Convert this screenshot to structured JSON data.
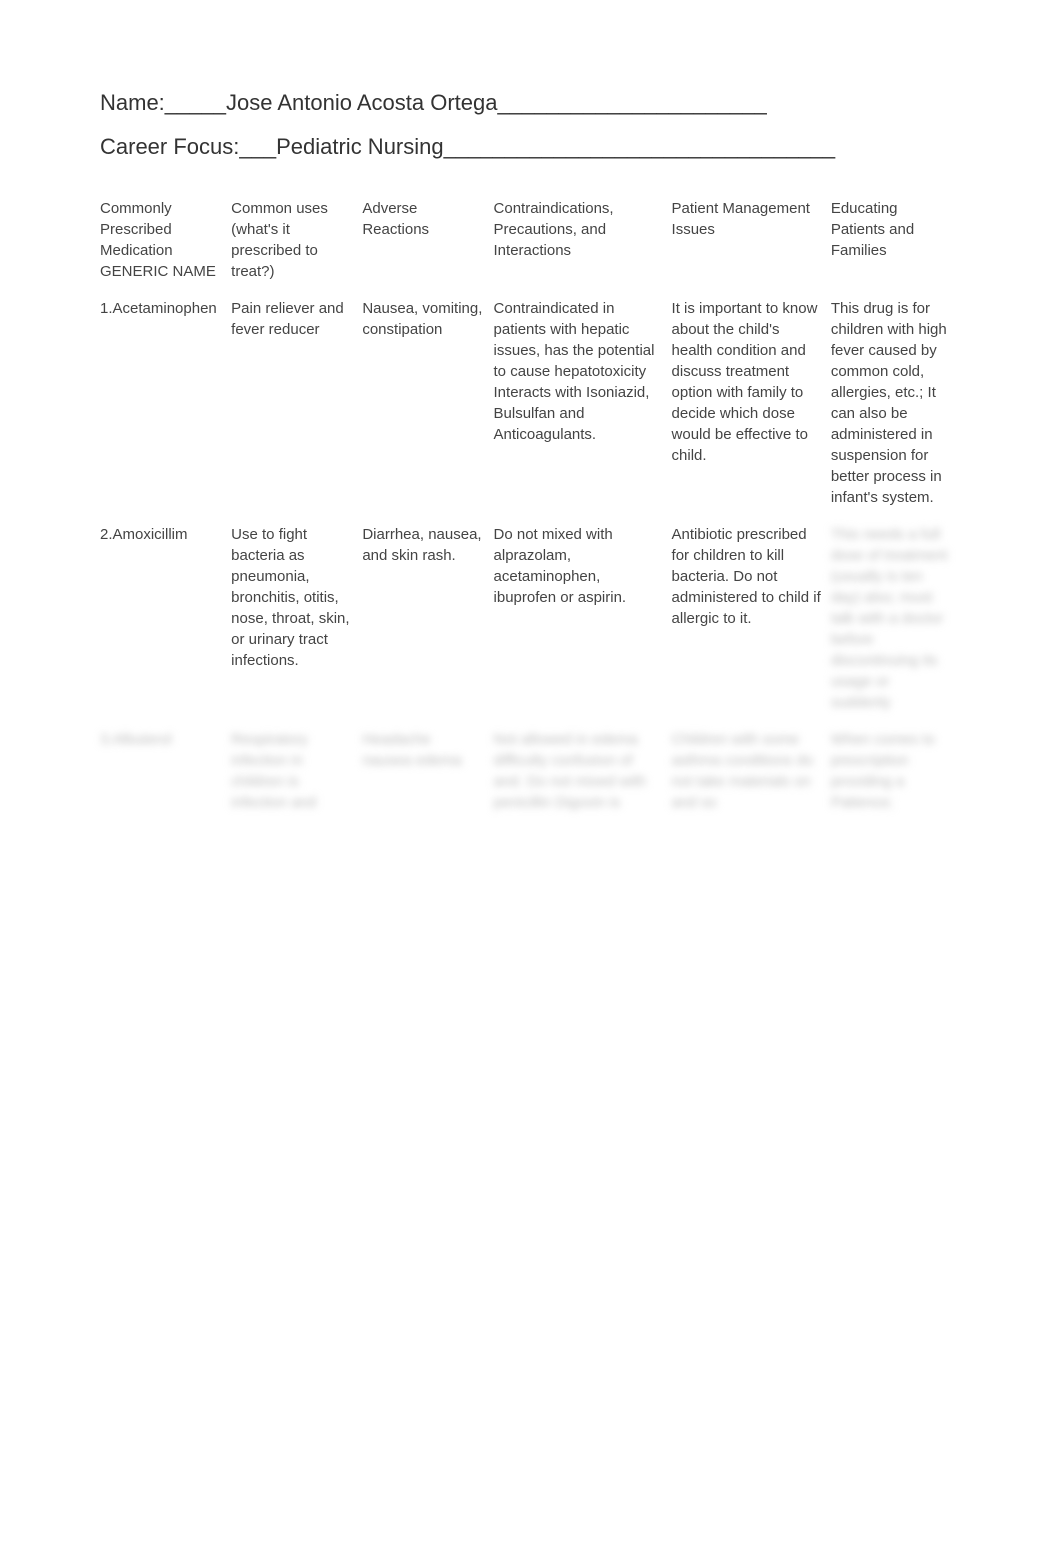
{
  "header": {
    "name_label": "Name:_____",
    "name_value": "Jose Antonio Acosta Ortega",
    "name_trailing": "______________________",
    "career_label": "Career Focus:___",
    "career_value": "Pediatric Nursing",
    "career_trailing": "________________________________"
  },
  "table": {
    "headers": [
      "Commonly Prescribed Medication GENERIC NAME",
      "Common uses (what's it prescribed to treat?)",
      "Adverse Reactions",
      "Contraindications, Precautions, and Interactions",
      "Patient Management Issues",
      "Educating Patients and Families"
    ],
    "rows": [
      {
        "cells": [
          "1.Acetaminophen",
          "Pain reliever and fever reducer",
          "Nausea, vomiting, constipation",
          "Contraindicated in patients with hepatic issues, has the potential to cause hepatotoxicity Interacts with Isoniazid, Bulsulfan and Anticoagulants.",
          "It is important to know about the child's health condition and discuss treatment option with family to decide which dose would be effective to child.",
          "This drug is for children with high fever caused by common cold, allergies, etc.; It can also be administered in suspension for better process in infant's system."
        ],
        "blurred": [
          false,
          false,
          false,
          false,
          false,
          false
        ]
      },
      {
        "cells": [
          "2.Amoxicillim",
          "Use to fight bacteria as pneumonia, bronchitis, otitis, nose, throat, skin, or urinary tract infections.",
          "Diarrhea, nausea, and skin rash.",
          "Do not mixed with alprazolam, acetaminophen, ibuprofen or aspirin.",
          "Antibiotic prescribed for children to kill bacteria. Do not administered to child if allergic to it.",
          "This needs a full dose of treatment (usually is ten day) also; must talk with a doctor before discontinuing its usage or suddenly"
        ],
        "blurred": [
          false,
          false,
          false,
          false,
          false,
          true
        ]
      },
      {
        "cells": [
          "3.Albuterol",
          "Respiratory infection in children is infection and",
          "Headache nausea edema",
          "Not allowed in edema difficulty confusion of and. Do not mixed with penicillin Digoxin is",
          "Children with some asthma conditions do not take materials on and so",
          "When comes to prescription providing a Patience;"
        ],
        "blurred": [
          true,
          true,
          true,
          true,
          true,
          true
        ]
      }
    ]
  }
}
